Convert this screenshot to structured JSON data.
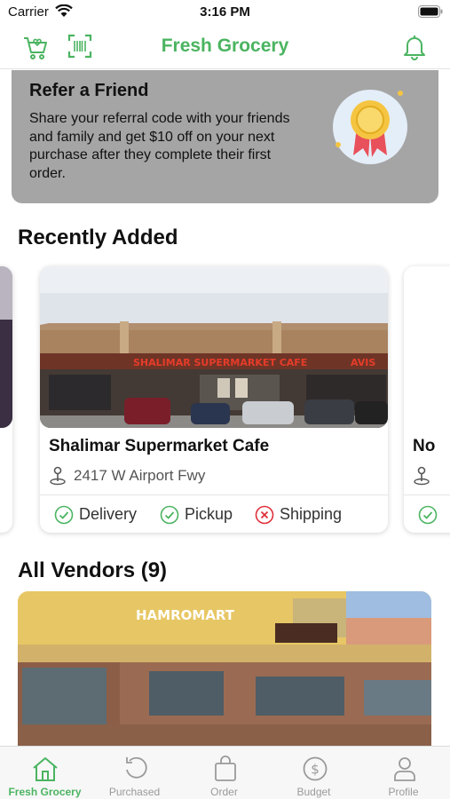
{
  "status_bar": {
    "carrier": "Carrier",
    "time": "3:16 PM"
  },
  "header": {
    "title": "Fresh Grocery",
    "accent_color": "#4bb461"
  },
  "refer": {
    "title": "Refer a Friend",
    "text": "Share your referral code with your friends and family and get $10 off on your next purchase after they complete their first order."
  },
  "recently_added": {
    "title": "Recently Added",
    "cards": [
      {
        "name": "Shalimar Supermarket Cafe",
        "address": "2417 W Airport Fwy",
        "tags": [
          {
            "label": "Delivery",
            "available": true
          },
          {
            "label": "Pickup",
            "available": true
          },
          {
            "label": "Shipping",
            "available": false
          }
        ]
      }
    ],
    "next_card_name_fragment": "No"
  },
  "all_vendors": {
    "title": "All Vendors (9)"
  },
  "tab_bar": {
    "tabs": [
      {
        "label": "Fresh Grocery",
        "icon": "home-icon",
        "active": true
      },
      {
        "label": "Purchased",
        "icon": "history-icon",
        "active": false
      },
      {
        "label": "Order",
        "icon": "bag-icon",
        "active": false
      },
      {
        "label": "Budget",
        "icon": "dollar-icon",
        "active": false
      },
      {
        "label": "Profile",
        "icon": "person-icon",
        "active": false
      }
    ]
  }
}
